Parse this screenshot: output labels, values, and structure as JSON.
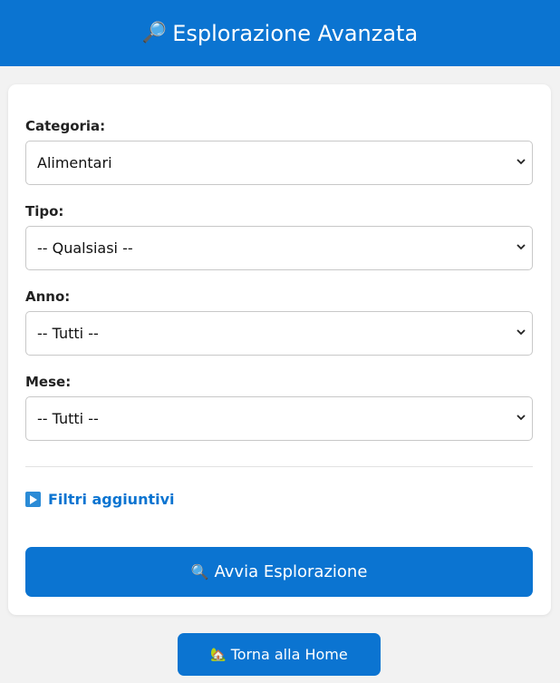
{
  "header": {
    "icon": "🔎",
    "title": "Esplorazione Avanzata"
  },
  "form": {
    "fields": [
      {
        "label": "Categoria:",
        "value": "Alimentari"
      },
      {
        "label": "Tipo:",
        "value": "-- Qualsiasi --"
      },
      {
        "label": "Anno:",
        "value": "-- Tutti --"
      },
      {
        "label": "Mese:",
        "value": "-- Tutti --"
      }
    ],
    "filters_label": "Filtri aggiuntivi",
    "run_button": {
      "icon": "🔍",
      "label": "Avvia Esplorazione"
    }
  },
  "home_button": {
    "icon": "🏡",
    "label": "Torna alla Home"
  },
  "colors": {
    "accent": "#0b74d1",
    "background": "#f2f2f2"
  },
  "icons": {
    "filters": "play-icon",
    "select_arrow": "chevron-down-icon"
  }
}
